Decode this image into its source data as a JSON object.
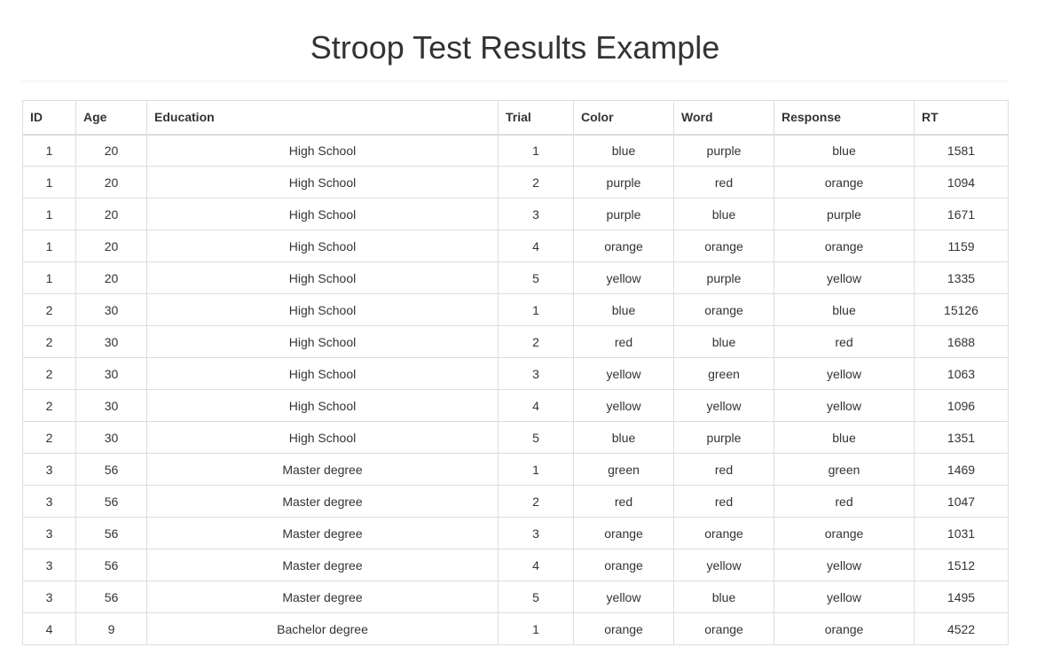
{
  "page": {
    "title": "Stroop Test Results Example"
  },
  "table": {
    "columns": [
      "ID",
      "Age",
      "Education",
      "Trial",
      "Color",
      "Word",
      "Response",
      "RT"
    ],
    "rows": [
      [
        "1",
        "20",
        "High School",
        "1",
        "blue",
        "purple",
        "blue",
        "1581"
      ],
      [
        "1",
        "20",
        "High School",
        "2",
        "purple",
        "red",
        "orange",
        "1094"
      ],
      [
        "1",
        "20",
        "High School",
        "3",
        "purple",
        "blue",
        "purple",
        "1671"
      ],
      [
        "1",
        "20",
        "High School",
        "4",
        "orange",
        "orange",
        "orange",
        "1159"
      ],
      [
        "1",
        "20",
        "High School",
        "5",
        "yellow",
        "purple",
        "yellow",
        "1335"
      ],
      [
        "2",
        "30",
        "High School",
        "1",
        "blue",
        "orange",
        "blue",
        "15126"
      ],
      [
        "2",
        "30",
        "High School",
        "2",
        "red",
        "blue",
        "red",
        "1688"
      ],
      [
        "2",
        "30",
        "High School",
        "3",
        "yellow",
        "green",
        "yellow",
        "1063"
      ],
      [
        "2",
        "30",
        "High School",
        "4",
        "yellow",
        "yellow",
        "yellow",
        "1096"
      ],
      [
        "2",
        "30",
        "High School",
        "5",
        "blue",
        "purple",
        "blue",
        "1351"
      ],
      [
        "3",
        "56",
        "Master degree",
        "1",
        "green",
        "red",
        "green",
        "1469"
      ],
      [
        "3",
        "56",
        "Master degree",
        "2",
        "red",
        "red",
        "red",
        "1047"
      ],
      [
        "3",
        "56",
        "Master degree",
        "3",
        "orange",
        "orange",
        "orange",
        "1031"
      ],
      [
        "3",
        "56",
        "Master degree",
        "4",
        "orange",
        "yellow",
        "yellow",
        "1512"
      ],
      [
        "3",
        "56",
        "Master degree",
        "5",
        "yellow",
        "blue",
        "yellow",
        "1495"
      ],
      [
        "4",
        "9",
        "Bachelor degree",
        "1",
        "orange",
        "orange",
        "orange",
        "4522"
      ]
    ]
  }
}
